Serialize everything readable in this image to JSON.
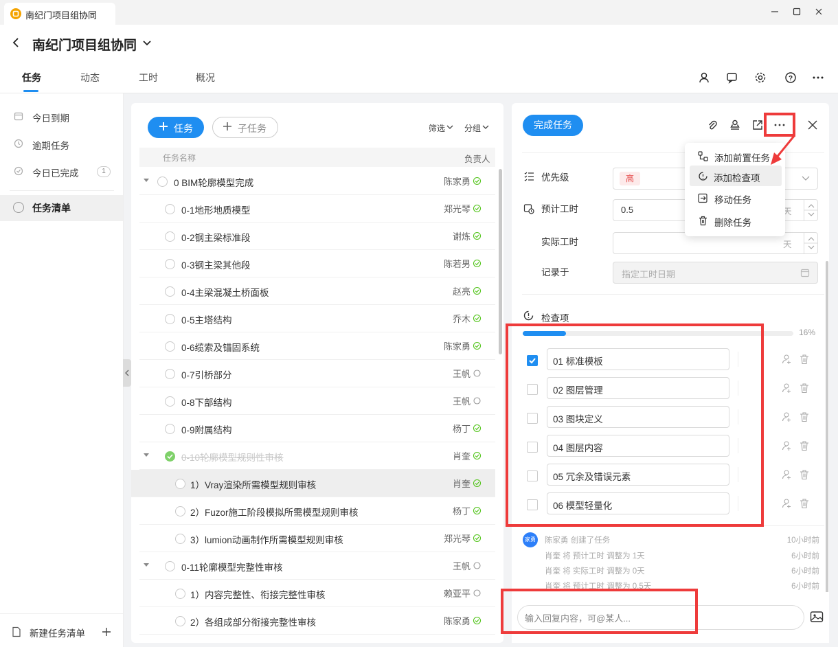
{
  "window": {
    "title": "南纪门项目组协同"
  },
  "header": {
    "title": "南纪门项目组协同"
  },
  "tabs": [
    "任务",
    "动态",
    "工时",
    "概况"
  ],
  "sidebar": {
    "items": [
      {
        "label": "今日到期"
      },
      {
        "label": "逾期任务"
      },
      {
        "label": "今日已完成",
        "count": "1"
      },
      {
        "label": "任务清单"
      }
    ],
    "new_list": "新建任务清单"
  },
  "tasklist": {
    "add_task": "任务",
    "add_subtask": "子任务",
    "filter": "筛选",
    "group": "分组",
    "col_name": "任务名称",
    "col_owner": "负责人",
    "rows": [
      {
        "name": "0 BIM轮廓模型完成",
        "owner": "陈家勇",
        "status": "done-tick"
      },
      {
        "name": "0-1地形地质模型",
        "owner": "郑光琴",
        "status": "done-tick"
      },
      {
        "name": "0-2钢主梁标准段",
        "owner": "谢炼",
        "status": "done-tick"
      },
      {
        "name": "0-3钢主梁其他段",
        "owner": "陈若男",
        "status": "done-tick"
      },
      {
        "name": "0-4主梁混凝土桥面板",
        "owner": "赵亮",
        "status": "done-tick"
      },
      {
        "name": "0-5主塔结构",
        "owner": "乔木",
        "status": "done-tick"
      },
      {
        "name": "0-6缆索及锚固系统",
        "owner": "陈家勇",
        "status": "done-tick"
      },
      {
        "name": "0-7引桥部分",
        "owner": "王帆",
        "status": "open"
      },
      {
        "name": "0-8下部结构",
        "owner": "王帆",
        "status": "open"
      },
      {
        "name": "0-9附属结构",
        "owner": "杨丁",
        "status": "done-tick"
      },
      {
        "name": "0-10轮廓模型规则性审核",
        "owner": "肖奎",
        "status": "done-tick"
      },
      {
        "name": "1）Vray渲染所需模型规则审核",
        "owner": "肖奎",
        "status": "done-tick"
      },
      {
        "name": "2）Fuzor施工阶段模拟所需模型规则审核",
        "owner": "杨丁",
        "status": "done-tick"
      },
      {
        "name": "3）lumion动画制作所需模型规则审核",
        "owner": "郑光琴",
        "status": "done-tick"
      },
      {
        "name": "0-11轮廓模型完整性审核",
        "owner": "王帆",
        "status": "open"
      },
      {
        "name": "1）内容完整性、衔接完整性审核",
        "owner": "赖亚平",
        "status": "open"
      },
      {
        "name": "2）各组成部分衔接完整性审核",
        "owner": "陈家勇",
        "status": "done-tick"
      }
    ]
  },
  "detail": {
    "complete_btn": "完成任务",
    "priority_label": "优先级",
    "priority_value": "高",
    "est_label": "预计工时",
    "est_value": "0.5",
    "unit": "天",
    "actual_label": "实际工时",
    "record_label": "记录于",
    "record_placeholder": "指定工时日期",
    "checklist_title": "检查项",
    "progress": 16,
    "progress_text": "16%",
    "checklist": [
      {
        "label": "01 标准模板",
        "checked": true
      },
      {
        "label": "02 图层管理",
        "checked": false
      },
      {
        "label": "03 图块定义",
        "checked": false
      },
      {
        "label": "04 图层内容",
        "checked": false
      },
      {
        "label": "05 冗余及错误元素",
        "checked": false
      },
      {
        "label": "06 模型轻量化",
        "checked": false
      }
    ],
    "activity": [
      {
        "avatar": "家勇",
        "name": "陈家勇",
        "text": "创建了任务",
        "time": "10小时前"
      },
      {
        "name": "肖奎",
        "text": "将 预计工时 调整为 1天",
        "time": "6小时前"
      },
      {
        "name": "肖奎",
        "text": "将 实际工时 调整为 0天",
        "time": "6小时前"
      },
      {
        "name": "肖奎",
        "text": "将 预计工时 调整为 0.5天",
        "time": "6小时前"
      }
    ],
    "reply_placeholder": "输入回复内容，可@某人..."
  },
  "menu": {
    "items": [
      "添加前置任务",
      "添加检查项",
      "移动任务",
      "删除任务"
    ]
  },
  "colors": {
    "accent": "#1f8ef1",
    "highlight": "#ee3b3b",
    "done": "#52c41a"
  }
}
